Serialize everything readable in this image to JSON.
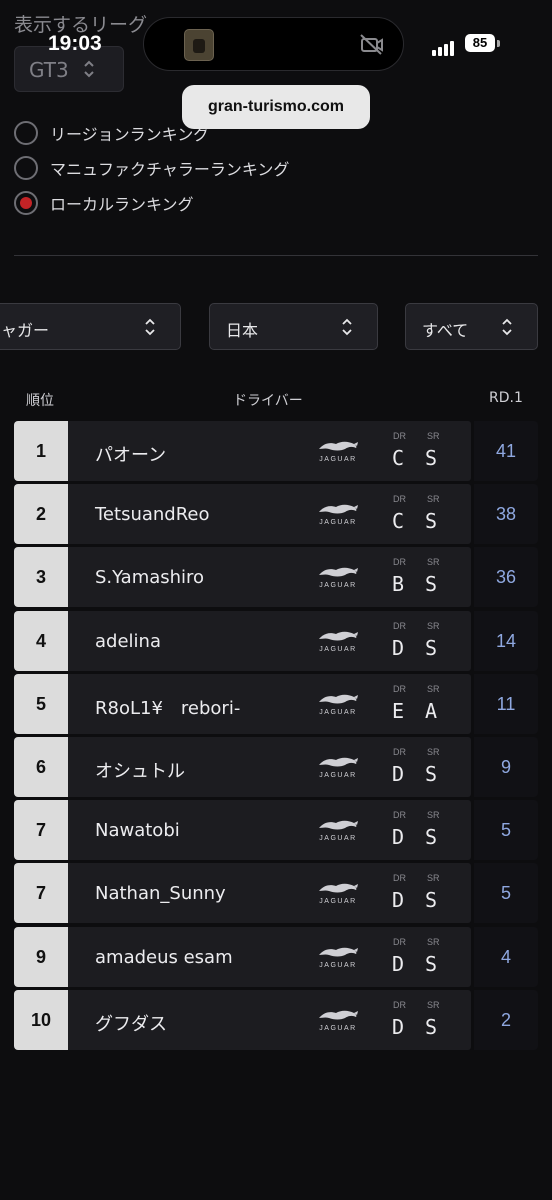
{
  "status_bar": {
    "time": "19:03",
    "battery": "85",
    "signal_icon": "cellular-signal-icon",
    "island_icon": "camera-off-icon"
  },
  "header": {
    "league_label": "表示するリーグ",
    "league_value": "GT3",
    "url": "gran-turismo.com"
  },
  "ranking_types": [
    {
      "label": "リージョンランキング",
      "selected": false
    },
    {
      "label": "マニュファクチャラーランキング",
      "selected": false
    },
    {
      "label": "ローカルランキング",
      "selected": true
    }
  ],
  "filters": [
    {
      "value": "ャガー"
    },
    {
      "value": "日本"
    },
    {
      "value": "すべて"
    }
  ],
  "table": {
    "headers": {
      "rank": "順位",
      "driver": "ドライバー",
      "round": "RD.1"
    },
    "dr_label": "DR",
    "sr_label": "SR",
    "brand_logo_text": "JAGUAR",
    "rows": [
      {
        "rank": "1",
        "name": "パオーン",
        "dr": "C",
        "sr": "S",
        "score": "41"
      },
      {
        "rank": "2",
        "name": "TetsuandReo",
        "dr": "C",
        "sr": "S",
        "score": "38"
      },
      {
        "rank": "3",
        "name": "S.Yamashiro",
        "dr": "B",
        "sr": "S",
        "score": "36"
      },
      {
        "rank": "4",
        "name": "adelina",
        "dr": "D",
        "sr": "S",
        "score": "14"
      },
      {
        "rank": "5",
        "name": "R8oL1¥　rebori-",
        "dr": "E",
        "sr": "A",
        "score": "11"
      },
      {
        "rank": "6",
        "name": "オシュトル",
        "dr": "D",
        "sr": "S",
        "score": "9"
      },
      {
        "rank": "7",
        "name": "Nawatobi",
        "dr": "D",
        "sr": "S",
        "score": "5"
      },
      {
        "rank": "7",
        "name": "Nathan_Sunny",
        "dr": "D",
        "sr": "S",
        "score": "5"
      },
      {
        "rank": "9",
        "name": "amadeus esam",
        "dr": "D",
        "sr": "S",
        "score": "4"
      },
      {
        "rank": "10",
        "name": "グフダス",
        "dr": "D",
        "sr": "S",
        "score": "2"
      }
    ]
  },
  "colors": {
    "background": "#0d0d0f",
    "radio_selected": "#c32326",
    "score_text": "#8fa8e0",
    "rank_box": "#dcdcdc"
  }
}
